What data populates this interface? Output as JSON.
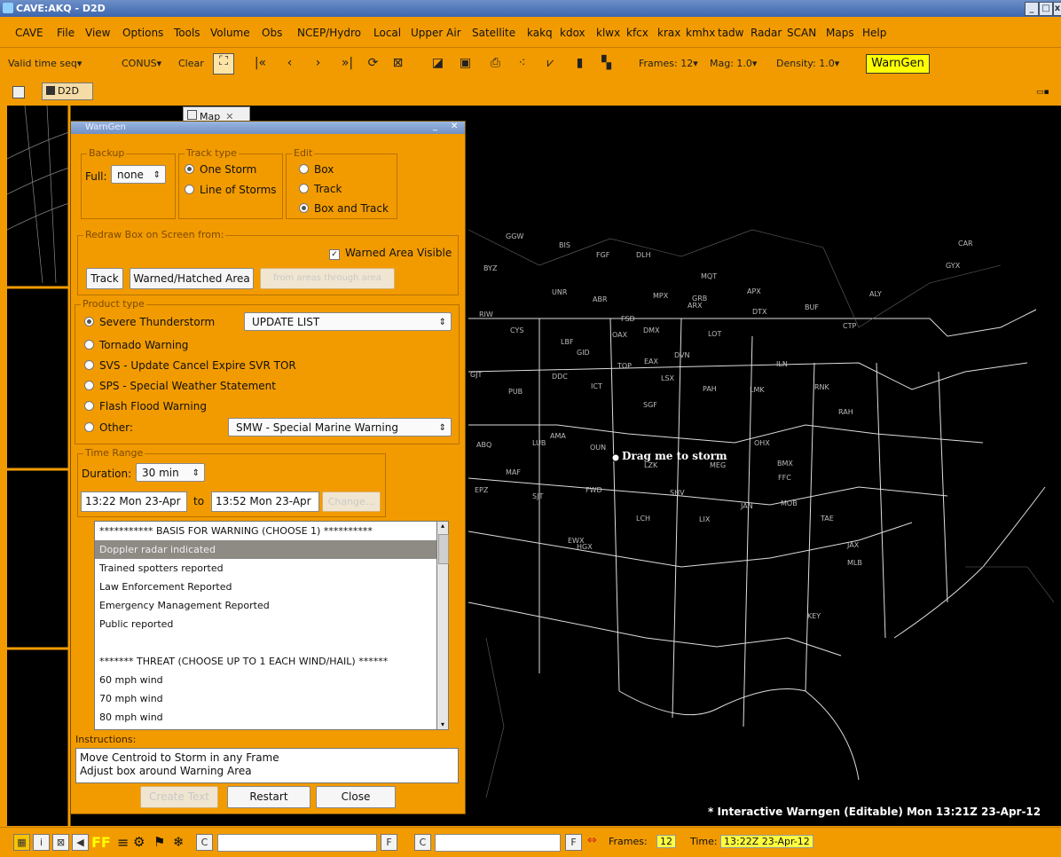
{
  "window": {
    "title": "CAVE:AKQ - D2D"
  },
  "menu": [
    "CAVE",
    "File",
    "View",
    "Options",
    "Tools",
    "Volume",
    "Obs",
    "NCEP/Hydro",
    "Local",
    "Upper Air",
    "Satellite",
    "kakq",
    "kdox",
    "klwx",
    "kfcx",
    "krax",
    "kmhx",
    "tadw",
    "Radar",
    "SCAN",
    "Maps",
    "Help"
  ],
  "toolbar": {
    "valid_time": "Valid time seq▾",
    "conus": "CONUS▾",
    "clear": "Clear",
    "frames": "Frames: 12▾",
    "mag": "Mag: 1.0▾",
    "density": "Density: 1.0▾",
    "warngen": "WarnGen"
  },
  "perspective": {
    "label": "D2D"
  },
  "map_tab": {
    "label": "Map"
  },
  "dialog": {
    "title": "WarnGen",
    "backup": {
      "label": "Backup",
      "full_label": "Full:",
      "value": "none"
    },
    "track_type": {
      "label": "Track type",
      "one": "One Storm",
      "line": "Line of Storms"
    },
    "edit": {
      "label": "Edit",
      "box": "Box",
      "track": "Track",
      "box_track": "Box and Track"
    },
    "redraw": {
      "label": "Redraw Box on Screen from:",
      "visible": "Warned Area Visible",
      "track_btn": "Track",
      "hatched_btn": "Warned/Hatched Area",
      "from_btn": "from areas through area"
    },
    "product": {
      "label": "Product type",
      "severe": "Severe Thunderstorm",
      "update_list": "UPDATE LIST",
      "tornado": "Tornado Warning",
      "svs": "SVS - Update Cancel Expire SVR TOR",
      "sps": "SPS - Special Weather Statement",
      "flash": "Flash Flood Warning",
      "other": "Other:",
      "other_value": "SMW - Special Marine Warning"
    },
    "time_range": {
      "label": "Time Range",
      "duration_label": "Duration:",
      "duration": "30 min",
      "start": "13:22 Mon 23-Apr",
      "to": "to",
      "end": "13:52 Mon 23-Apr",
      "change": "Change..."
    },
    "bullets": [
      "*********** BASIS FOR WARNING (CHOOSE 1) **********",
      "Doppler radar indicated",
      "Trained spotters reported",
      "Law Enforcement Reported",
      "Emergency Management Reported",
      "Public reported",
      "",
      "******* THREAT (CHOOSE UP TO 1 EACH WIND/HAIL) ******",
      "60 mph wind",
      "70 mph wind",
      "80 mph wind"
    ],
    "instructions_label": "Instructions:",
    "instructions": [
      "Move Centroid to Storm in any Frame",
      "Adjust box around Warning Area"
    ],
    "create_text": "Create Text",
    "restart": "Restart",
    "close": "Close"
  },
  "map": {
    "drag_label": "Drag me to storm",
    "footer": "* Interactive Warngen (Editable)   Mon 13:21Z 23-Apr-12",
    "stations": [
      "GGW",
      "BIS",
      "FGF",
      "DLH",
      "MQT",
      "APX",
      "GRB",
      "BYZ",
      "UNR",
      "ABR",
      "MPX",
      "ARX",
      "DTX",
      "BUF",
      "ALY",
      "RIW",
      "CYS",
      "FSD",
      "DMX",
      "LOT",
      "CTP",
      "LBF",
      "OAX",
      "GID",
      "DVN",
      "ILN",
      "RNK",
      "GJT",
      "DDC",
      "EAX",
      "LSX",
      "PAH",
      "LMK",
      "RAH",
      "PUB",
      "ICT",
      "TOP",
      "AMA",
      "OUN",
      "SGF",
      "LZK",
      "MEG",
      "OHX",
      "ABQ",
      "LUB",
      "FWD",
      "SHV",
      "JAN",
      "BMX",
      "FFC",
      "EPZ",
      "MAF",
      "SJT",
      "EWX",
      "HGX",
      "LCH",
      "LIX",
      "MOB",
      "TAE",
      "JAX",
      "MLB",
      "KEY",
      "CAR",
      "GYX"
    ]
  },
  "status": {
    "frames_label": "Frames:",
    "frames": "12",
    "time_label": "Time:",
    "time": "13:22Z 23-Apr-12"
  }
}
